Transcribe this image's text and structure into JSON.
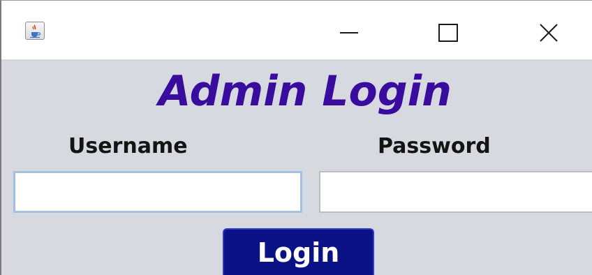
{
  "window": {
    "icon": "java-cup-icon",
    "controls": {
      "minimize_icon": "minimize-icon",
      "maximize_icon": "maximize-icon",
      "close_icon": "close-icon"
    }
  },
  "form": {
    "title": "Admin Login",
    "title_color": "#3a0c9e",
    "background_color": "#d6d9e0",
    "username_label": "Username",
    "username_value": "",
    "password_label": "Password",
    "password_value": "",
    "login_button_label": "Login",
    "login_button_color": "#0b1286"
  }
}
